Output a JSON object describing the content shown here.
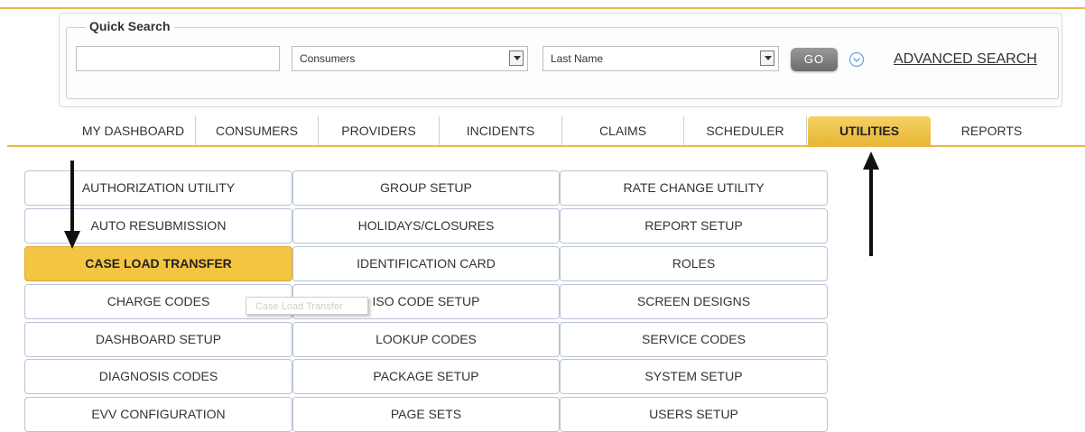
{
  "quick_search": {
    "legend": "Quick Search",
    "input_value": "",
    "type_select": "Consumers",
    "field_select": "Last Name",
    "go_label": "GO",
    "advanced_search_label": "ADVANCED SEARCH"
  },
  "nav": {
    "tabs": [
      {
        "label": "MY DASHBOARD",
        "active": false
      },
      {
        "label": "CONSUMERS",
        "active": false
      },
      {
        "label": "PROVIDERS",
        "active": false
      },
      {
        "label": "INCIDENTS",
        "active": false
      },
      {
        "label": "CLAIMS",
        "active": false
      },
      {
        "label": "SCHEDULER",
        "active": false
      },
      {
        "label": "UTILITIES",
        "active": true
      },
      {
        "label": "REPORTS",
        "active": false
      }
    ]
  },
  "utilities": {
    "columns": [
      [
        "AUTHORIZATION UTILITY",
        "AUTO RESUBMISSION",
        "CASE LOAD TRANSFER",
        "CHARGE CODES",
        "DASHBOARD SETUP",
        "DIAGNOSIS CODES",
        "EVV CONFIGURATION"
      ],
      [
        "GROUP SETUP",
        "HOLIDAYS/CLOSURES",
        "IDENTIFICATION CARD",
        "ISO CODE SETUP",
        "LOOKUP CODES",
        "PACKAGE SETUP",
        "PAGE SETS"
      ],
      [
        "RATE CHANGE UTILITY",
        "REPORT SETUP",
        "ROLES",
        "SCREEN DESIGNS",
        "SERVICE CODES",
        "SYSTEM SETUP",
        "USERS SETUP"
      ]
    ],
    "highlighted": "CASE LOAD TRANSFER",
    "tooltip": "Case Load Transfer"
  },
  "colors": {
    "accent": "#e8b84a",
    "highlight": "#f4c542",
    "cell_border": "#b8c4d6"
  },
  "icons": [
    "dropdown-caret-icon",
    "expand-circle-icon",
    "down-arrow-annotation",
    "up-arrow-annotation"
  ]
}
